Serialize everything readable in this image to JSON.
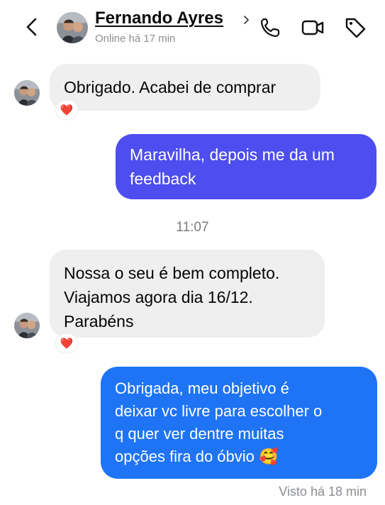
{
  "header": {
    "contact_name": "Fernando Ayres",
    "status": "Online há 17 min",
    "icons": [
      "back-chevron-icon",
      "avatar",
      "phone-icon",
      "video-camera-icon",
      "tag-icon"
    ]
  },
  "messages": [
    {
      "direction": "incoming",
      "text": "Obrigado. Acabei de comprar",
      "reaction": "❤️"
    },
    {
      "direction": "outgoing",
      "text": "Maravilha, depois me da um\nfeedback"
    },
    {
      "direction": "incoming",
      "text": "Nossa o seu é bem completo.\nViajamos agora dia 16/12.\nParabéns",
      "reaction": "❤️"
    },
    {
      "direction": "outgoing",
      "text": "Obrigada, meu objetivo é\ndeixar vc livre para escolher o\nq quer ver dentre muitas\nopções fira do óbvio 🥰"
    }
  ],
  "timestamp": "11:07",
  "seen_status": "Visto há 18 min",
  "colors": {
    "incoming_bubble": "#efefef",
    "outgoing_bubble_1": "#4d4df0",
    "outgoing_bubble_2": "#1e74f4",
    "muted_text": "#8a8d91"
  }
}
